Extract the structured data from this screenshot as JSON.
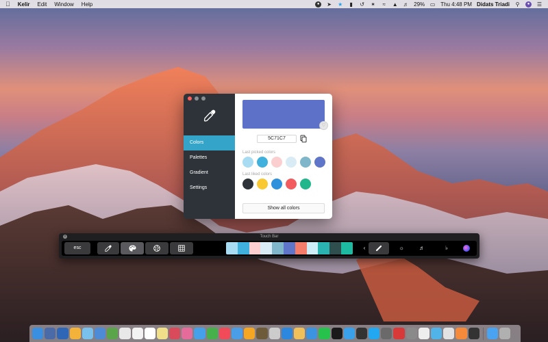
{
  "menubar": {
    "app_name": "Kelir",
    "menus": [
      "Edit",
      "Window",
      "Help"
    ],
    "battery": "29%",
    "clock": "Thu 4:48 PM",
    "user": "Didats Triadi"
  },
  "app": {
    "nav": [
      {
        "label": "Colors",
        "active": true
      },
      {
        "label": "Palettes",
        "active": false
      },
      {
        "label": "Gradient",
        "active": false
      },
      {
        "label": "Settings",
        "active": false
      }
    ],
    "current_color": "5C71C7",
    "current_color_hex": "#5C71C7",
    "last_picked_label": "Last picked colors",
    "last_picked": [
      "#a8dcf3",
      "#3fb1dc",
      "#fbcfd0",
      "#d9ebf4",
      "#7fb6c9",
      "#5f76c8"
    ],
    "last_liked_label": "Last liked colors",
    "last_liked": [
      "#2d3339",
      "#f8c932",
      "#2e91db",
      "#f25c5f",
      "#22b68c"
    ],
    "show_all_label": "Show all colors",
    "accent": "#34a5c8"
  },
  "touchbar": {
    "title": "Touch Bar",
    "esc_label": "esc",
    "tools": [
      "eyedropper-icon",
      "palette-icon",
      "aperture-icon",
      "grid-icon"
    ],
    "palette": [
      "#a8dcf3",
      "#3fb1dc",
      "#fbcfd0",
      "#d9ebf4",
      "#7fb6c9",
      "#5f76c8",
      "#f47c6b",
      "#cdeef7",
      "#2bb3b1",
      "#2f4f4f",
      "#1db9a0"
    ],
    "controls": [
      "chevron-left-icon",
      "brightness-icon",
      "volume-icon",
      "mute-icon",
      "siri-icon"
    ]
  },
  "dock": {
    "icons": [
      "#3a8fe0",
      "#4b6aa8",
      "#2f66b5",
      "#f3b23a",
      "#7ac0ec",
      "#4d8bd6",
      "#5aa54a",
      "#e8e8e8",
      "#f2f2f2",
      "#ffffff",
      "#f0e08a",
      "#d94a5a",
      "#e56b9a",
      "#44a0e8",
      "#46b04a",
      "#f14a58",
      "#4a9ee8",
      "#f5a623",
      "#6e5b3a",
      "#cccccc",
      "#2c87de",
      "#f0c05a",
      "#3c94e0",
      "#27c24c",
      "#1a1a1a",
      "#3aa0ea",
      "#333333",
      "#22a8f0",
      "#6a6a6a",
      "#d83a3a",
      "#8a8a8a",
      "#eeeeee",
      "#50b4e8",
      "#e2e2e2",
      "#f58a3a",
      "#333333",
      "#4aa3f0",
      "#b0b0b0"
    ]
  }
}
